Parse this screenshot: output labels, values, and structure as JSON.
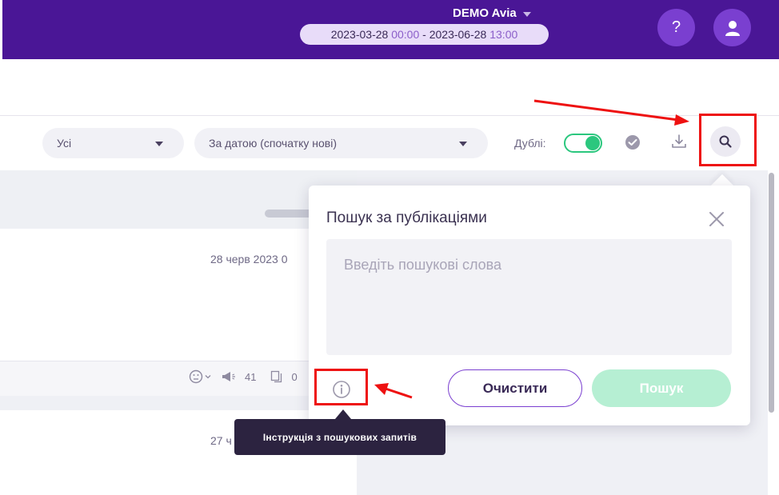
{
  "header": {
    "project_name": "DEMO Avia",
    "date_from": "2023-03-28",
    "time_from": "00:00",
    "date_separator": " - ",
    "date_to": "2023-06-28",
    "time_to": "13:00",
    "help_label": "?",
    "help_icon": "question-icon",
    "user_icon": "user-icon"
  },
  "filters": {
    "type_select": "Усі",
    "sort_select": "За датою (спочатку нові)",
    "duplicates_label": "Дублі:",
    "duplicates_on": true,
    "icons": [
      "check-circle-icon",
      "download-icon",
      "search-icon"
    ]
  },
  "feed": {
    "card1_date": "28 черв 2023 0",
    "card1_reactions_icon": "emoji-icon",
    "card1_mentions": "41",
    "card1_copies": "0",
    "card2_date": "27 ч"
  },
  "search_popup": {
    "title": "Пошук за публікаціями",
    "placeholder": "Введіть пошукові слова",
    "clear_label": "Очистити",
    "search_label": "Пошук",
    "info_icon": "info-icon",
    "close_icon": "close-icon"
  },
  "tooltip": {
    "text": "Інструкція з пошукових запитів"
  },
  "colors": {
    "header_bg": "#4a1696",
    "accent_purple": "#7a3fd0",
    "toggle_green": "#2bc77e",
    "search_button_bg": "#b6efd3",
    "annotation_red": "#ee1111"
  }
}
